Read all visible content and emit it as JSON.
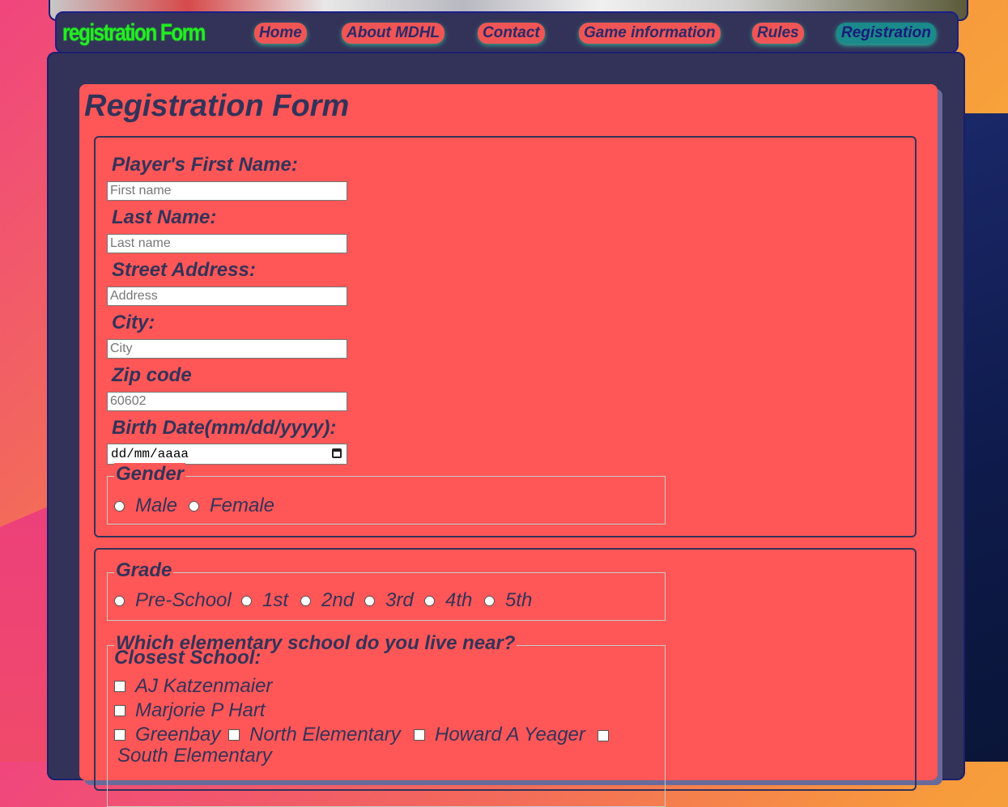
{
  "header": {
    "brand": "registration Form"
  },
  "nav": [
    {
      "label": "Home"
    },
    {
      "label": "About MDHL"
    },
    {
      "label": "Contact"
    },
    {
      "label": "Game information"
    },
    {
      "label": "Rules"
    },
    {
      "label": "Registration",
      "active": true
    }
  ],
  "form": {
    "title": "Registration Form",
    "first_name": {
      "label": "Player's First Name:",
      "placeholder": "First name"
    },
    "last_name": {
      "label": "Last Name:",
      "placeholder": "Last name"
    },
    "street": {
      "label": "Street Address:",
      "placeholder": "Address"
    },
    "city": {
      "label": "City:",
      "placeholder": "City"
    },
    "zip": {
      "label": "Zip code",
      "placeholder": "60602"
    },
    "birth": {
      "label": "Birth Date(mm/dd/yyyy):",
      "value": "dd/mm/aaaa"
    },
    "gender": {
      "legend": "Gender",
      "options": [
        "Male",
        "Female"
      ]
    },
    "grade": {
      "legend": "Grade",
      "options": [
        "Pre-School",
        "1st",
        "2nd",
        "3rd",
        "4th",
        "5th"
      ]
    },
    "school": {
      "legend": "Which elementary school do you live near?",
      "label": "Closest School:",
      "options": [
        "AJ Katzenmaier",
        "Marjorie P Hart",
        "Greenbay",
        "North Elementary",
        "Howard A Yeager",
        "South Elementary"
      ]
    }
  },
  "colors": {
    "accent": "#ff5757",
    "panel": "#333359",
    "brand": "#22ee22",
    "active_tab": "#1a8a8a"
  }
}
